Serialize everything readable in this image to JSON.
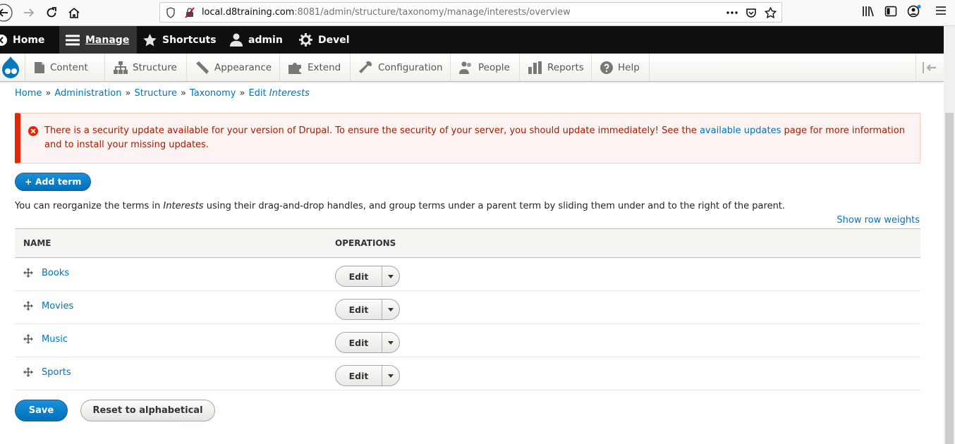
{
  "browser": {
    "url_host": "local.d8training.com",
    "url_rest": ":8081/admin/structure/taxonomy/manage/interests/overview",
    "icons": [
      "back-icon",
      "forward-icon",
      "reload-icon",
      "home-icon",
      "tracking-shield-icon",
      "insecure-lock-icon",
      "page-actions-icon",
      "pocket-icon",
      "bookmark-star-icon",
      "library-icon",
      "sidebar-icon",
      "account-icon",
      "menu-icon"
    ]
  },
  "toolbar": {
    "home": "Home",
    "manage": "Manage",
    "shortcuts": "Shortcuts",
    "user": "admin",
    "devel": "Devel"
  },
  "tray": {
    "items": [
      {
        "label": "Content",
        "icon": "content-icon"
      },
      {
        "label": "Structure",
        "icon": "structure-icon"
      },
      {
        "label": "Appearance",
        "icon": "appearance-icon"
      },
      {
        "label": "Extend",
        "icon": "extend-icon"
      },
      {
        "label": "Configuration",
        "icon": "configuration-icon"
      },
      {
        "label": "People",
        "icon": "people-icon"
      },
      {
        "label": "Reports",
        "icon": "reports-icon"
      },
      {
        "label": "Help",
        "icon": "help-icon"
      }
    ]
  },
  "breadcrumb": {
    "items": [
      "Home",
      "Administration",
      "Structure",
      "Taxonomy"
    ],
    "current_prefix": "Edit",
    "current_em": "Interests",
    "separator": "»"
  },
  "alert": {
    "text_before": "There is a security update available for your version of Drupal. To ensure the security of your server, you should update immediately! See the",
    "link": "available updates",
    "text_after": "page for more information and to install your missing updates.",
    "color": "#e62600"
  },
  "actions": {
    "add_term": "+ Add term",
    "save": "Save",
    "reset": "Reset to alphabetical"
  },
  "help": {
    "before": "You can reorganize the terms in",
    "em": "Interests",
    "after": "using their drag-and-drop handles, and group terms under a parent term by sliding them under and to the right of the parent."
  },
  "show_row_weights": "Show row weights",
  "table": {
    "columns": [
      "NAME",
      "OPERATIONS"
    ],
    "rows": [
      {
        "name": "Books",
        "operation": "Edit"
      },
      {
        "name": "Movies",
        "operation": "Edit"
      },
      {
        "name": "Music",
        "operation": "Edit"
      },
      {
        "name": "Sports",
        "operation": "Edit"
      }
    ]
  },
  "colors": {
    "link": "#0074bd",
    "primary_button": "#0071b8",
    "toolbar_dark": "#0f0f0f"
  }
}
